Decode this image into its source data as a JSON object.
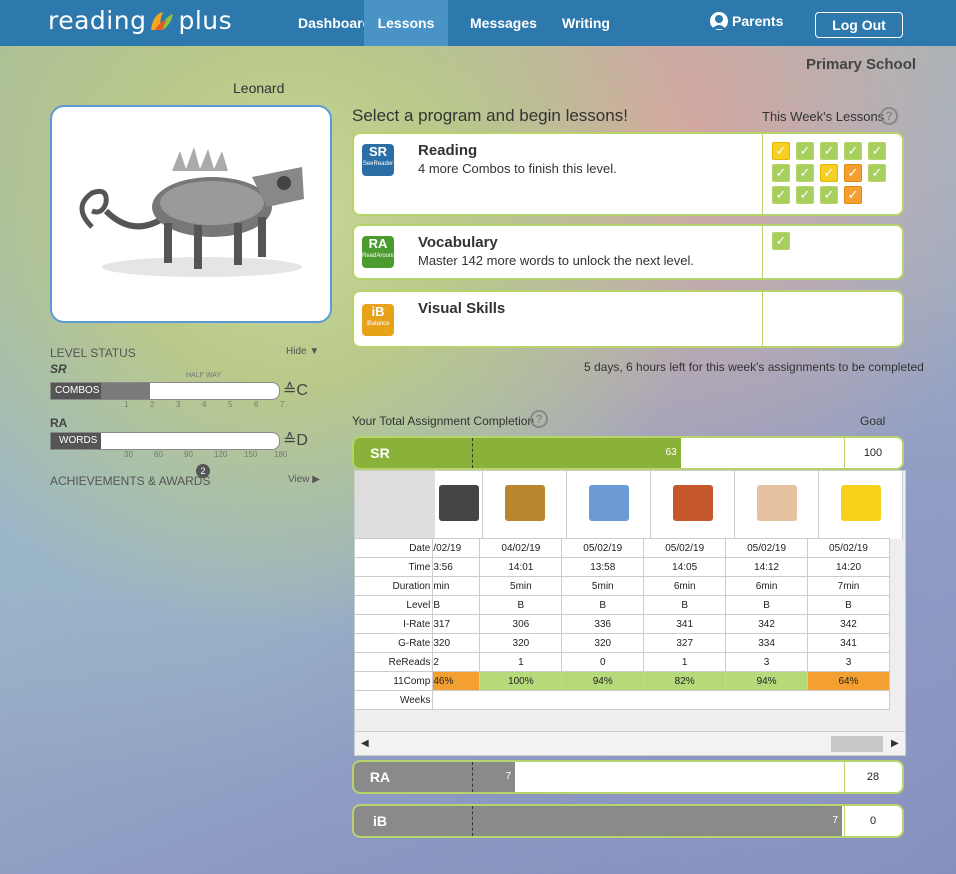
{
  "header": {
    "logo_text_left": "reading",
    "logo_text_right": "plus",
    "nav": [
      "Dashboard",
      "Lessons",
      "Messages",
      "Writing"
    ],
    "active_nav": "Lessons",
    "parents_label": "Parents",
    "logout_label": "Log Out"
  },
  "school": "Primary School",
  "user": {
    "name": "Leonard"
  },
  "level_status": {
    "title": "LEVEL STATUS",
    "hide_label": "Hide",
    "sr_badge": "SR",
    "half_way_label": "HALF WAY",
    "combos_label": "COMBOS",
    "combos_value": "3",
    "combos_ticks": [
      "1",
      "2",
      "3",
      "4",
      "5",
      "6",
      "7"
    ],
    "combos_level": "C",
    "combos_progress": 0.43,
    "ra_badge": "RA",
    "words_label": "WORDS",
    "words_value": "38",
    "words_ticks": [
      "30",
      "60",
      "90",
      "120",
      "150",
      "180"
    ],
    "words_level": "D",
    "words_progress": 0.21
  },
  "achievements": {
    "label": "ACHIEVEMENTS & AWARDS",
    "badge": "2",
    "view_label": "View"
  },
  "lessons": {
    "heading": "Select a program and begin lessons!",
    "week_label": "This Week's Lessons",
    "programs": [
      {
        "icon": "SR",
        "icon_sub": "SeeReader",
        "title": "Reading",
        "desc": "4 more Combos to finish this level."
      },
      {
        "icon": "RA",
        "icon_sub": "ReadAround",
        "title": "Vocabulary",
        "desc": "Master 142 more words to unlock the next level."
      },
      {
        "icon": "iB",
        "icon_sub": "iBalance",
        "title": "Visual Skills",
        "desc": ""
      }
    ],
    "reading_checks": [
      "yellow",
      "green",
      "green",
      "green",
      "green",
      "green",
      "green",
      "yellow",
      "orange",
      "green",
      "green",
      "green",
      "green",
      "orange"
    ],
    "vocab_checks": [
      "green"
    ],
    "time_left": "5 days, 6 hours left for this week's assignments to be completed"
  },
  "completion": {
    "title": "Your Total Assignment Completion",
    "goal_label": "Goal",
    "rows": [
      {
        "badge": "SR",
        "value": "63",
        "goal": "100",
        "fraction": 0.63
      },
      {
        "badge": "RA",
        "value": "7",
        "goal": "28",
        "fraction": 0.25
      },
      {
        "badge": "iB",
        "value": "7",
        "goal": "0",
        "fraction": 1.0
      }
    ]
  },
  "table": {
    "labels": [
      "Date",
      "Time",
      "Duration",
      "Level",
      "I-Rate",
      "G-Rate",
      "ReReads",
      "11Comp",
      "Weeks"
    ],
    "columns": [
      {
        "Date": "/02/19",
        "Time": "3:56",
        "Duration": "min",
        "Level": "B",
        "I-Rate": "317",
        "G-Rate": "320",
        "ReReads": "2",
        "11Comp": "46%",
        "comp_color": "orange"
      },
      {
        "Date": "04/02/19",
        "Time": "14:01",
        "Duration": "5min",
        "Level": "B",
        "I-Rate": "306",
        "G-Rate": "320",
        "ReReads": "1",
        "11Comp": "100%",
        "comp_color": "green"
      },
      {
        "Date": "05/02/19",
        "Time": "13:58",
        "Duration": "5min",
        "Level": "B",
        "I-Rate": "336",
        "G-Rate": "320",
        "ReReads": "0",
        "11Comp": "94%",
        "comp_color": "green"
      },
      {
        "Date": "05/02/19",
        "Time": "14:05",
        "Duration": "6min",
        "Level": "B",
        "I-Rate": "341",
        "G-Rate": "327",
        "ReReads": "1",
        "11Comp": "82%",
        "comp_color": "green"
      },
      {
        "Date": "05/02/19",
        "Time": "14:12",
        "Duration": "6min",
        "Level": "B",
        "I-Rate": "342",
        "G-Rate": "334",
        "ReReads": "3",
        "11Comp": "94%",
        "comp_color": "green"
      },
      {
        "Date": "05/02/19",
        "Time": "14:20",
        "Duration": "7min",
        "Level": "B",
        "I-Rate": "342",
        "G-Rate": "341",
        "ReReads": "3",
        "11Comp": "64%",
        "comp_color": "orange"
      }
    ]
  },
  "colors": {
    "topbar": "#2d79ad",
    "green": "#8ab23a",
    "card_border": "#b7d36a",
    "orange": "#f3a030",
    "yellow": "#f6cf25"
  }
}
